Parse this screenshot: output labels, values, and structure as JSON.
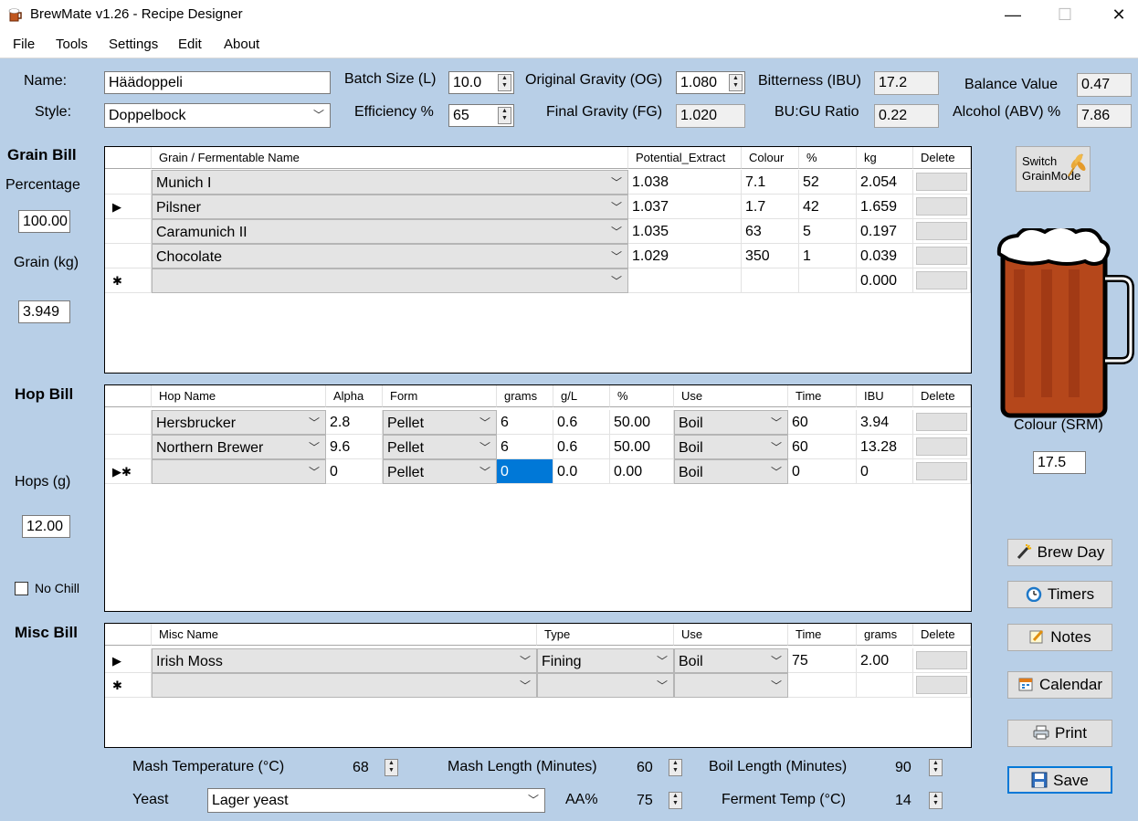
{
  "window": {
    "title": "BrewMate v1.26 - Recipe Designer",
    "minimize": "—",
    "maximize": "☐",
    "close": "✕"
  },
  "menu": [
    "File",
    "Tools",
    "Settings",
    "Edit",
    "About"
  ],
  "recipe": {
    "name_label": "Name:",
    "name_value": "Häädoppeli",
    "style_label": "Style:",
    "style_value": "Doppelbock",
    "batch_label": "Batch Size (L)",
    "batch_value": "10.0",
    "efficiency_label": "Efficiency %",
    "efficiency_value": "65",
    "og_label": "Original Gravity (OG)",
    "og_value": "1.080",
    "fg_label": "Final Gravity (FG)",
    "fg_value": "1.020",
    "ibu_label": "Bitterness (IBU)",
    "ibu_value": "17.2",
    "bugu_label": "BU:GU Ratio",
    "bugu_value": "0.22",
    "balance_label": "Balance Value",
    "balance_value": "0.47",
    "abv_label": "Alcohol (ABV) %",
    "abv_value": "7.86"
  },
  "grain_side": {
    "title": "Grain Bill",
    "percentage_label": "Percentage",
    "percentage_value": "100.00",
    "grain_kg_label": "Grain (kg)",
    "grain_kg_value": "3.949"
  },
  "grain_grid": {
    "headers": [
      "Grain / Fermentable Name",
      "Potential_Extract",
      "Colour",
      "%",
      "kg",
      "Delete"
    ],
    "rows": [
      {
        "marker": "",
        "name": "Munich I",
        "extract": "1.038",
        "colour": "7.1",
        "pct": "52",
        "kg": "2.054"
      },
      {
        "marker": "▶",
        "name": "Pilsner",
        "extract": "1.037",
        "colour": "1.7",
        "pct": "42",
        "kg": "1.659"
      },
      {
        "marker": "",
        "name": "Caramunich II",
        "extract": "1.035",
        "colour": "63",
        "pct": "5",
        "kg": "0.197"
      },
      {
        "marker": "",
        "name": "Chocolate",
        "extract": "1.029",
        "colour": "350",
        "pct": "1",
        "kg": "0.039"
      },
      {
        "marker": "✱",
        "name": "",
        "extract": "",
        "colour": "",
        "pct": "",
        "kg": "0.000"
      }
    ]
  },
  "hop_side": {
    "title": "Hop Bill",
    "hops_label": "Hops (g)",
    "hops_value": "12.00",
    "no_chill_label": "No Chill"
  },
  "hop_grid": {
    "headers": [
      "Hop Name",
      "Alpha",
      "Form",
      "grams",
      "g/L",
      "%",
      "Use",
      "Time",
      "IBU",
      "Delete"
    ],
    "rows": [
      {
        "marker": "",
        "name": "Hersbrucker",
        "alpha": "2.8",
        "form": "Pellet",
        "grams": "6",
        "gl": "0.6",
        "pct": "50.00",
        "use": "Boil",
        "time": "60",
        "ibu": "3.94"
      },
      {
        "marker": "",
        "name": "Northern Brewer",
        "alpha": "9.6",
        "form": "Pellet",
        "grams": "6",
        "gl": "0.6",
        "pct": "50.00",
        "use": "Boil",
        "time": "60",
        "ibu": "13.28"
      },
      {
        "marker": "▶✱",
        "name": "",
        "alpha": "0",
        "form": "Pellet",
        "grams": "0",
        "gl": "0.0",
        "pct": "0.00",
        "use": "Boil",
        "time": "0",
        "ibu": "0"
      }
    ]
  },
  "misc_side": {
    "title": "Misc Bill"
  },
  "misc_grid": {
    "headers": [
      "Misc Name",
      "Type",
      "Use",
      "Time",
      "grams",
      "Delete"
    ],
    "rows": [
      {
        "marker": "▶",
        "name": "Irish Moss",
        "type": "Fining",
        "use": "Boil",
        "time": "75",
        "grams": "2.00"
      },
      {
        "marker": "✱",
        "name": "",
        "type": "",
        "use": "",
        "time": "",
        "grams": ""
      }
    ]
  },
  "right_panel": {
    "switch_label_1": "Switch",
    "switch_label_2": "GrainMode",
    "colour_label": "Colour (SRM)",
    "colour_value": "17.5",
    "beer_color": "#b5471b",
    "buttons": {
      "brew_day": "Brew Day",
      "timers": "Timers",
      "notes": "Notes",
      "calendar": "Calendar",
      "print": "Print",
      "save": "Save"
    }
  },
  "bottom": {
    "mash_temp_label": "Mash Temperature (°C)",
    "mash_temp_value": "68",
    "mash_length_label": "Mash Length (Minutes)",
    "mash_length_value": "60",
    "boil_length_label": "Boil Length (Minutes)",
    "boil_length_value": "90",
    "yeast_label": "Yeast",
    "yeast_value": "Lager yeast",
    "aa_label": "AA%",
    "aa_value": "75",
    "ferment_label": "Ferment Temp (°C)",
    "ferment_value": "14"
  }
}
